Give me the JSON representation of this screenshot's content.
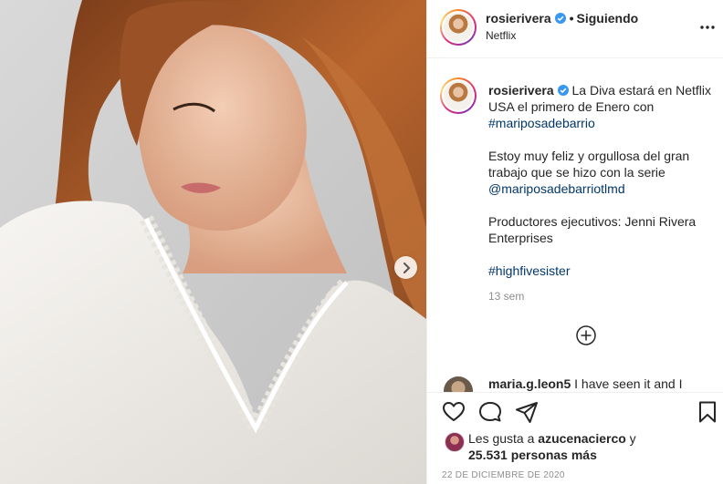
{
  "post": {
    "image_alt": "Foto de mujer con blusa blanca"
  },
  "header": {
    "username": "rosierivera",
    "separator": "•",
    "follow_status": "Siguiendo",
    "location": "Netflix"
  },
  "caption": {
    "username": "rosierivera",
    "line1": "La Diva estará en Netflix USA el primero de Enero con",
    "hashtag1": "#mariposadebarrio",
    "line2": "Estoy muy feliz y orgullosa del gran trabajo que se hizo con la serie",
    "mention": "@mariposadebarriotlmd",
    "line3": "Productores ejecutivos: Jenni Rivera Enterprises",
    "hashtag2": "#highfivesister",
    "time_ago": "13 sem"
  },
  "next_comment": {
    "username": "maria.g.leon5",
    "text": "I have seen it and I"
  },
  "likes": {
    "prefix": "Les gusta a ",
    "user": "azucenacierco",
    "suffix": " y",
    "others": "25.531 personas más"
  },
  "date": "22 DE DICIEMBRE DE 2020",
  "colors": {
    "verified": "#3897f0",
    "link": "#00376b",
    "muted": "#8e8e8e"
  },
  "icons": {
    "like": "heart-icon",
    "comment": "comment-icon",
    "share": "paper-plane-icon",
    "save": "bookmark-icon",
    "more": "more-options-icon",
    "next": "chevron-right-icon",
    "load_more": "plus-circle-icon"
  }
}
